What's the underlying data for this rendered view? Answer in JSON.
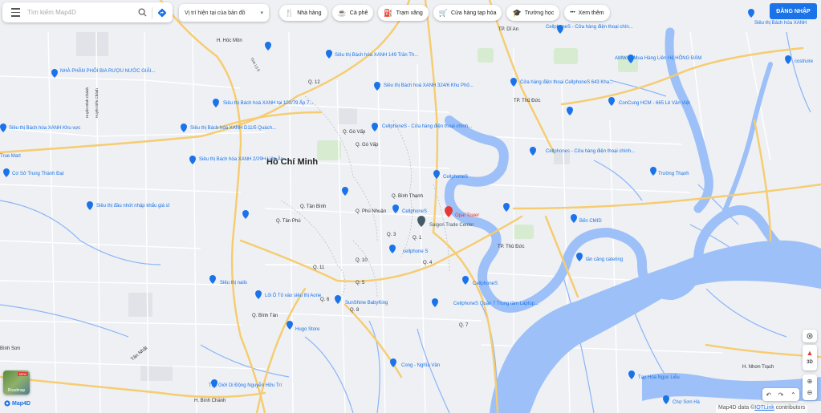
{
  "search": {
    "placeholder": "Tìm kiếm Map4D"
  },
  "location": {
    "label": "Vị trí hiện tại của bản đồ"
  },
  "categories": [
    {
      "icon": "restaurant-icon",
      "glyph": "🍴",
      "label": "Nhà hàng"
    },
    {
      "icon": "coffee-icon",
      "glyph": "☕",
      "label": "Cà phê"
    },
    {
      "icon": "gas-station-icon",
      "glyph": "⛽",
      "label": "Trạm xăng"
    },
    {
      "icon": "cart-icon",
      "glyph": "🛒",
      "label": "Cửa hàng tạp hóa"
    },
    {
      "icon": "school-icon",
      "glyph": "🎓",
      "label": "Trường học"
    },
    {
      "icon": "more-icon",
      "glyph": "•••",
      "label": "Xem thêm"
    }
  ],
  "login": {
    "label": "ĐĂNG NHẬP"
  },
  "controls": {
    "mode_3d": "3D"
  },
  "layer": {
    "badge": "NEW",
    "label": "Roadmap"
  },
  "brand": {
    "label": "Map4D"
  },
  "attribution": {
    "prefix": "Map4D data ©",
    "link": "IOTLink",
    "suffix": " contributors"
  },
  "map": {
    "city_label": "Hồ Chí Minh",
    "area_labels": [
      "H. Hóc Môn",
      "Q. 12",
      "Q. Gò Vấp",
      "Q. Gò Vấp",
      "Q. Bình Thạnh",
      "Q. Tân Bình",
      "Q. Phú Nhuận",
      "Q. Tân Phú",
      "Q. 3",
      "Q. 1",
      "Q. 10",
      "Q. 11",
      "Q. 4",
      "Q. 5",
      "Q. 6",
      "Q. 8",
      "Q. Bình Tân",
      "Q. 7",
      "TP. Thủ Đức",
      "TP. Thủ Đức",
      "TP. Dĩ An",
      "H. Bình Chánh",
      "H. Nhơn Trạch",
      "Bình Sơn",
      "Tân Nhật",
      "Huyện Bình Chánh",
      "Huyện Bến Chánh",
      "Tỉnh Lộ 9"
    ],
    "pois": [
      {
        "label": "Siêu thị Bách hóa XANH 149 Trần Th..."
      },
      {
        "label": "NHÀ PHÂN PHỐI BIA RƯỢU NƯỚC GIẢI..."
      },
      {
        "label": "Siêu thị Bách hoá XANH 324/6 Khu Phố..."
      },
      {
        "label": "Siêu thị Bách hoá XANH tại 102/79 Ấp 7..."
      },
      {
        "label": "Siêu thị Bách hóa XANH Khu vực"
      },
      {
        "label": "Siêu thị Bách hóa XANH D11/5 Quách..."
      },
      {
        "label": "CellphoneS - Cửa hàng điện thoại chính..."
      },
      {
        "label": "True Mart"
      },
      {
        "label": "Siêu thị Bách hóa XANH 2/29H Liên Ấp..."
      },
      {
        "label": "Cơ Sở Trung Thành Đạt"
      },
      {
        "label": "CellphoneS"
      },
      {
        "label": "Siêu thị đầu nhớt nhập khẩu giá sỉ"
      },
      {
        "label": "CellphoneS"
      },
      {
        "label": "Opal Tower"
      },
      {
        "label": "Saigon Trade Center"
      },
      {
        "label": "cellphone S"
      },
      {
        "label": "Siêu thị nails"
      },
      {
        "label": "Lối Ô Tô vào siêu thị Aone"
      },
      {
        "label": "SunShine BabyKing"
      },
      {
        "label": "Hugo Store"
      },
      {
        "label": "CellphoneS"
      },
      {
        "label": "CellphoneS Quận 7 Trung tâm Laptop..."
      },
      {
        "label": "Thế Giới Di Động Nguyễn Hữu Trí"
      },
      {
        "label": "Cửa hàng điện thoại CellphoneS 643 Kha..."
      },
      {
        "label": "Cellphones - Cửa hàng điện thoại chính..."
      },
      {
        "label": "CellphoneS - Cửa hàng điện thoại chín..."
      },
      {
        "label": "AMWAY Mua Hàng Liên Hệ HỒNG ĐÀM"
      },
      {
        "label": "ConCung HCM - 665 Lê Văn Việt"
      },
      {
        "label": "Trường Thạnh"
      },
      {
        "label": "Bến CMID"
      },
      {
        "label": "tân cảng catering"
      },
      {
        "label": "Cong - Nghĩa Vân"
      },
      {
        "label": "Tạp Hóa Ngọc Liễu"
      },
      {
        "label": "Chợ Sơn Hà"
      },
      {
        "label": "costruire"
      },
      {
        "label": "Siêu thị Bách hóa XANH"
      }
    ]
  }
}
